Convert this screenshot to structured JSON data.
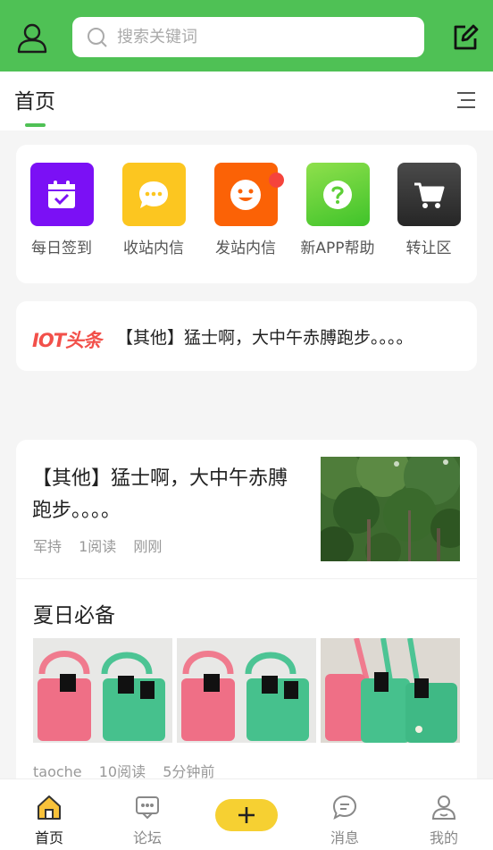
{
  "header": {
    "search_placeholder": "搜索关键词"
  },
  "tabs": {
    "home": "首页"
  },
  "shortcuts": [
    {
      "label": "每日签到",
      "icon": "calendar-check-icon",
      "color": "#7b10f5"
    },
    {
      "label": "收站内信",
      "icon": "chat-bubble-icon",
      "color": "#fcc620"
    },
    {
      "label": "发站内信",
      "icon": "smiley-icon",
      "color": "#fb6206",
      "badge": true
    },
    {
      "label": "新APP帮助",
      "icon": "question-icon",
      "color": "#6ad93a"
    },
    {
      "label": "转让区",
      "icon": "cart-icon",
      "color": "#333333"
    }
  ],
  "ticker": {
    "logo": "IOT头条",
    "text": "【其他】猛士啊，大中午赤膊跑步。。。。"
  },
  "feed": {
    "post1": {
      "title": "【其他】猛士啊，大中午赤膊跑步。。。。",
      "author": "军持",
      "reads": "1阅读",
      "time": "刚刚"
    },
    "post2": {
      "title": "夏日必备",
      "author": "taoche",
      "reads": "10阅读",
      "time": "5分钟前"
    }
  },
  "bottom_nav": {
    "home": "首页",
    "forum": "论坛",
    "messages": "消息",
    "mine": "我的"
  },
  "colors": {
    "brand_green": "#4fc155",
    "plus_yellow": "#f6d032"
  }
}
